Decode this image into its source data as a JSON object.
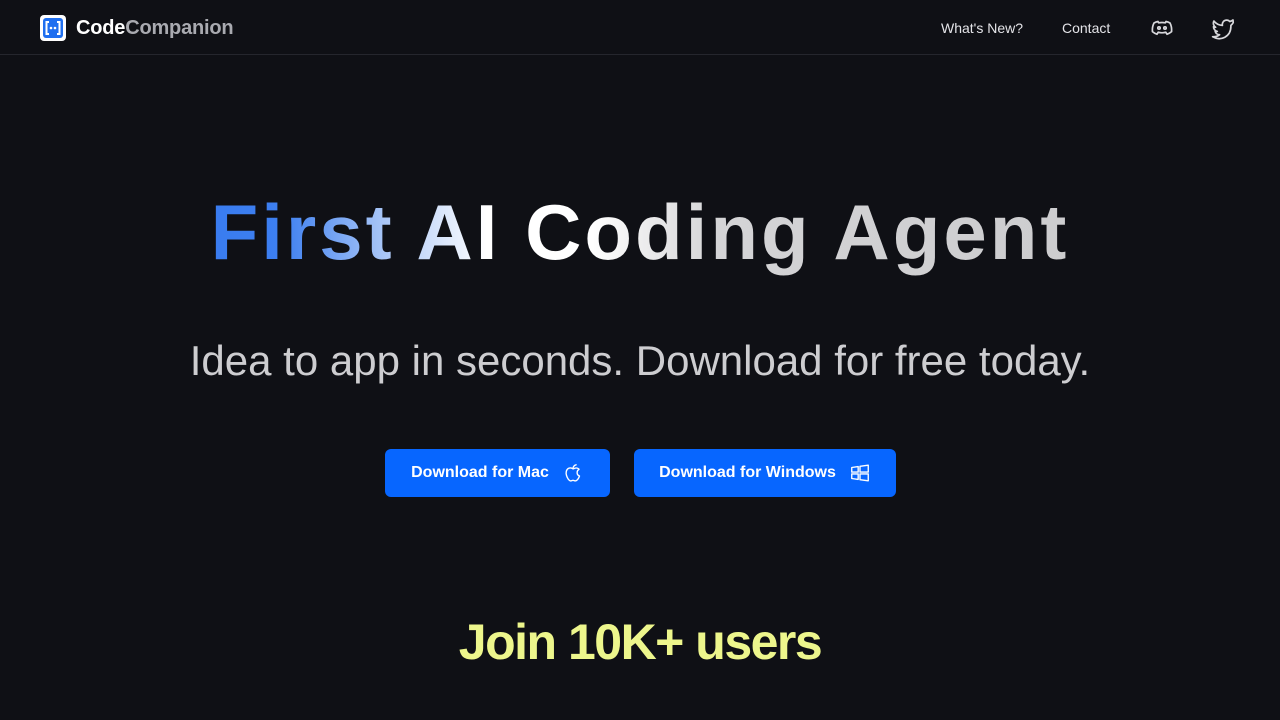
{
  "nav": {
    "logo_code": "Code",
    "logo_companion": "Companion",
    "logo_icon": "code-companion-logo-icon",
    "links": [
      {
        "label": "What's New?"
      },
      {
        "label": "Contact"
      }
    ],
    "social_icons": [
      "discord-icon",
      "twitter-icon"
    ]
  },
  "hero": {
    "title": "First AI Coding Agent",
    "subtitle": "Idea to app in seconds. Download for free today."
  },
  "buttons": {
    "mac_label": "Download for Mac",
    "mac_icon": "apple-icon",
    "windows_label": "Download for Windows",
    "windows_icon": "windows-icon"
  },
  "social_proof": {
    "heading": "Join 10K+ users"
  },
  "colors": {
    "background": "#0f1015",
    "accent_blue": "#0766ff",
    "gradient_blue": "#2f74ee",
    "highlight_yellow": "#edf68c",
    "muted_text": "#a9aab0"
  }
}
